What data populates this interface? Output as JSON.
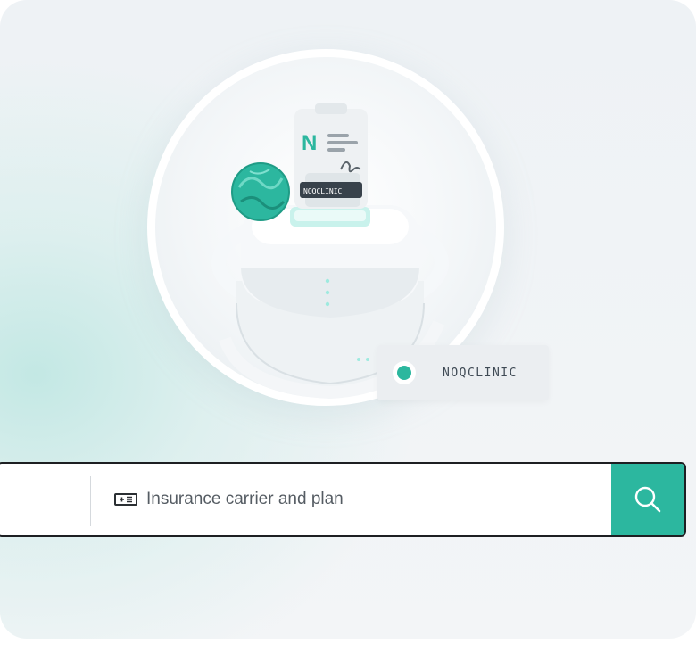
{
  "hero": {
    "brand_text": "NOQCLINIC",
    "document_brand": "NOQCLINIC"
  },
  "search": {
    "placeholder": "Insurance carrier and plan",
    "icon": "card-icon",
    "button_icon": "search-icon"
  },
  "colors": {
    "accent": "#2cb79f",
    "status_dot": "#2bb79e",
    "background": "#eef2f5"
  }
}
